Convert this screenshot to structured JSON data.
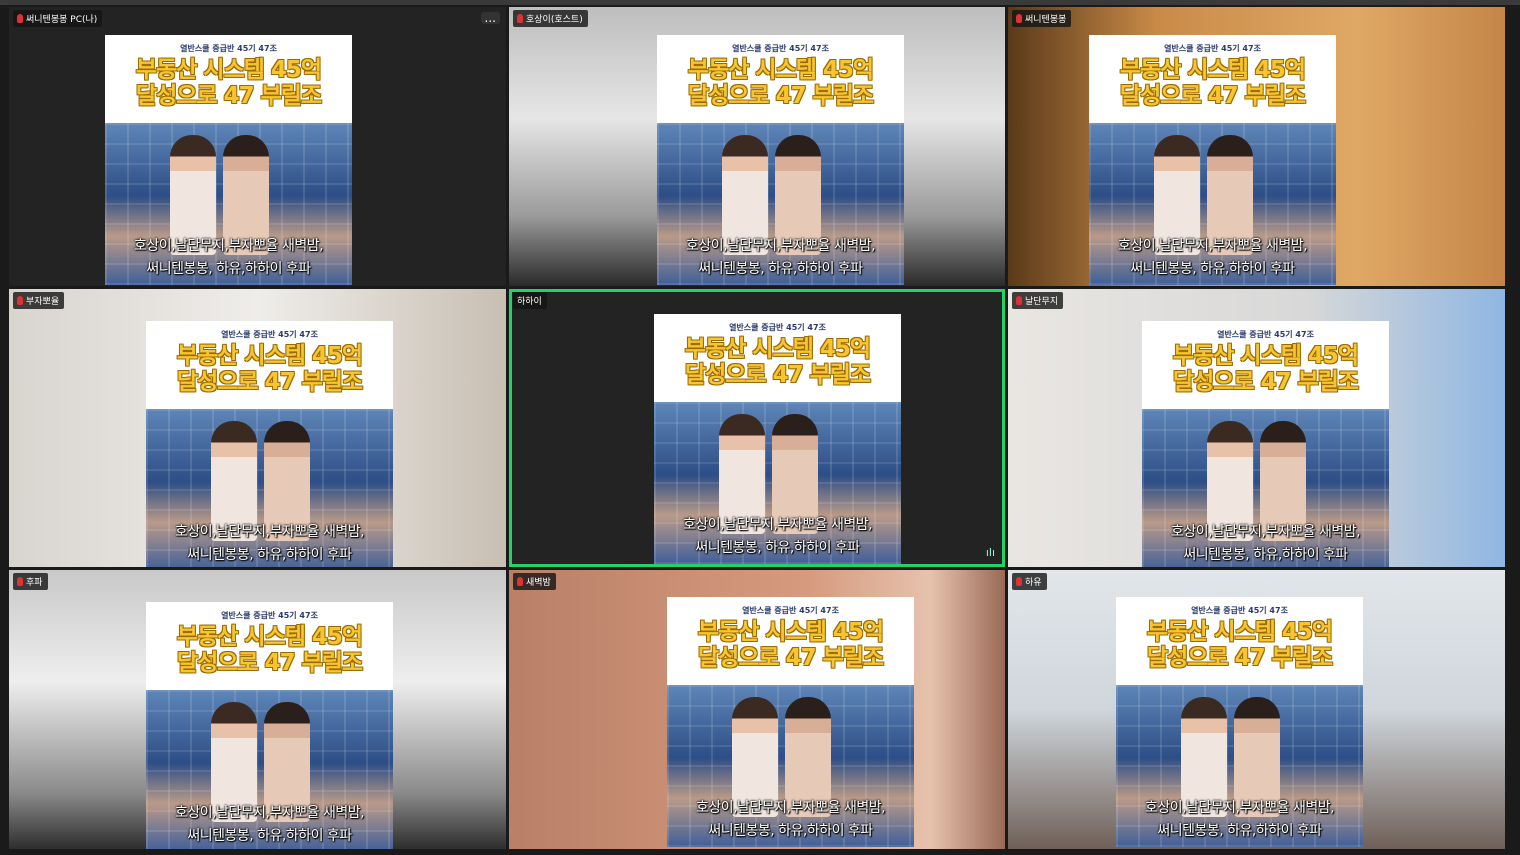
{
  "colors": {
    "active_speaker": "#22d36a",
    "headline": "#f7c531",
    "mic_muted": "#dd3333"
  },
  "poster": {
    "subtitle": "열반스쿨 중급반 45기 47조",
    "headline_1": "부동산 시스템 45억",
    "headline_2": "달성으로 47 부릴조",
    "caption_1": "호상이,날단무지,부자뽀율 새벽밤,",
    "caption_2": "써니텐봉봉, 하유,하하이 후파"
  },
  "more_label": "...",
  "participants": [
    {
      "name": "써니텐봉봉 PC(나)",
      "muted": true,
      "active": false
    },
    {
      "name": "호상이(호스트)",
      "muted": true,
      "active": false
    },
    {
      "name": "써니텐봉봉",
      "muted": true,
      "active": false
    },
    {
      "name": "부자뽀율",
      "muted": true,
      "active": false
    },
    {
      "name": "하하이",
      "muted": false,
      "active": true
    },
    {
      "name": "날단무지",
      "muted": true,
      "active": false
    },
    {
      "name": "후파",
      "muted": true,
      "active": false
    },
    {
      "name": "새벽밤",
      "muted": true,
      "active": false
    },
    {
      "name": "하유",
      "muted": true,
      "active": false
    }
  ]
}
